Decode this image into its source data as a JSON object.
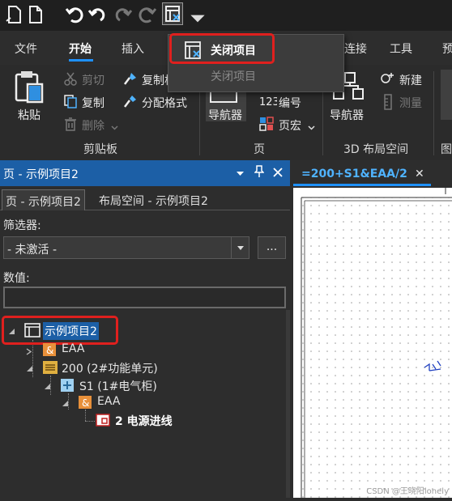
{
  "ribbon_tabs": [
    "文件",
    "开始",
    "插入",
    "连接",
    "工具",
    "预"
  ],
  "popup": {
    "title": "关闭项目",
    "subtitle": "关闭项目"
  },
  "clipboard": {
    "paste": "粘贴",
    "cut": "剪切",
    "copy_format": "复制格",
    "copy": "复制",
    "assign_format": "分配格式",
    "delete": "删除",
    "group_label": "剪贴板"
  },
  "page_group": {
    "navigator": "导航器",
    "number": "编号",
    "page_macro": "页宏",
    "group_label": "页"
  },
  "layout3d": {
    "navigator": "导航器",
    "new": "新建",
    "measure": "测量",
    "group_label": "3D 布局空间"
  },
  "edge_label": "图",
  "panel": {
    "title": "页 - 示例项目2",
    "tabs": [
      "页 - 示例项目2",
      "布局空间 - 示例项目2"
    ],
    "filter_label": "筛选器:",
    "filter_value": "- 未激活 -",
    "filter_more": "...",
    "value_label": "数值:"
  },
  "tree": {
    "root": "示例项目2",
    "eaa_top": "EAA",
    "func_unit": "200 (2#功能单元)",
    "cabinet": "S1 (1#电气柜)",
    "eaa_child": "EAA",
    "page": "2 电源进线"
  },
  "doc_tab": {
    "title": "=200+S1&EAA/2",
    "close": "✕"
  },
  "watermark": "CSDN @王晓阳lonely",
  "colors": {
    "accent": "#1e90ff",
    "highlight": "#e0201e",
    "panel_header": "#1c5fa6"
  }
}
